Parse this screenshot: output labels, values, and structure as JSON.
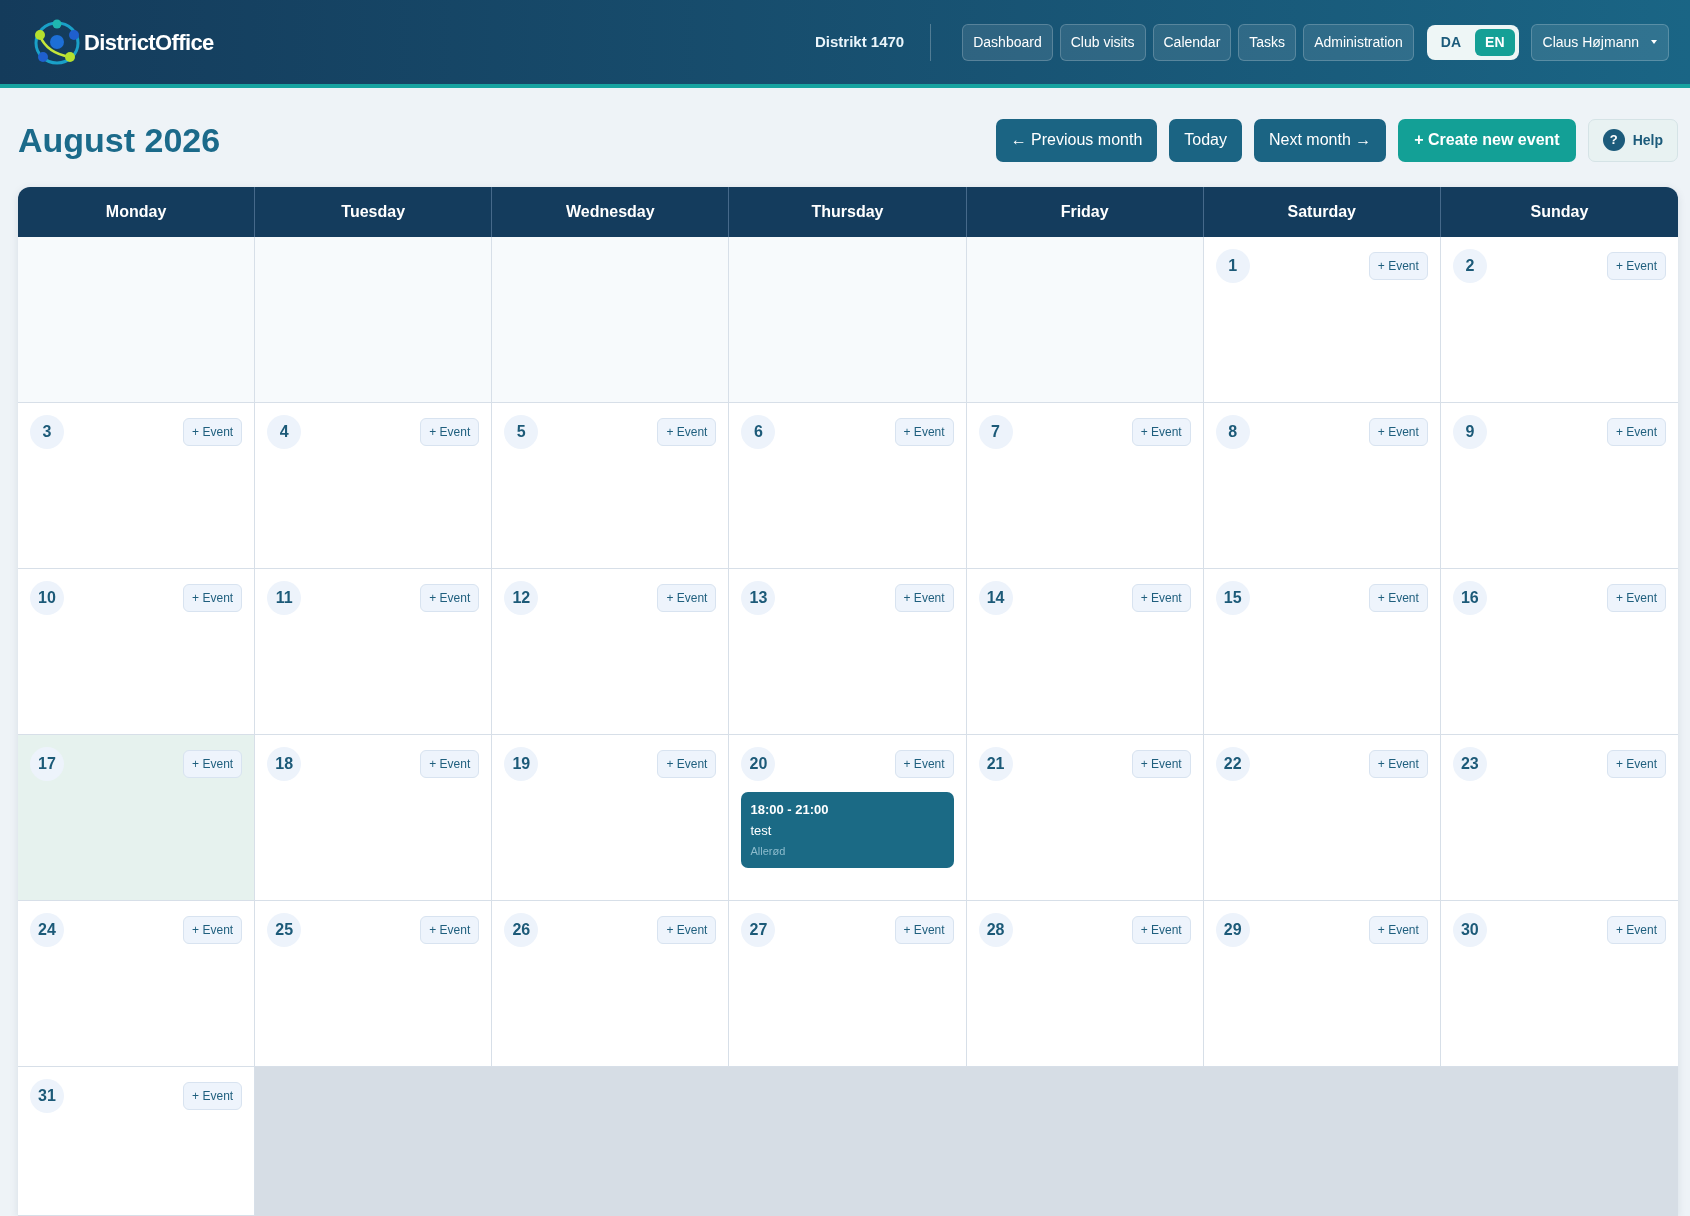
{
  "header": {
    "logo_text": "DistrictOffice",
    "district": "Distrikt 1470",
    "nav": [
      "Dashboard",
      "Club visits",
      "Calendar",
      "Tasks",
      "Administration"
    ],
    "languages": [
      {
        "label": "DA",
        "selected": false
      },
      {
        "label": "EN",
        "selected": true
      }
    ],
    "user": "Claus Højmann"
  },
  "toolbar": {
    "title": "August 2026",
    "buttons": [
      {
        "kind": "nav",
        "label": "← Previous month"
      },
      {
        "kind": "nav",
        "label": "Today"
      },
      {
        "kind": "nav",
        "label": "Next month →"
      },
      {
        "kind": "primary",
        "label": "+ Create new event"
      },
      {
        "kind": "help",
        "icon": "?",
        "label": "Help"
      }
    ]
  },
  "calendar": {
    "weekdays": [
      "Monday",
      "Tuesday",
      "Wednesday",
      "Thursday",
      "Friday",
      "Saturday",
      "Sunday"
    ],
    "weeks": [
      [
        {
          "kind": "lead"
        },
        {
          "kind": "lead"
        },
        {
          "kind": "lead"
        },
        {
          "kind": "lead"
        },
        {
          "kind": "lead"
        },
        {
          "kind": "day",
          "day": "1",
          "add": "+ Event",
          "today": false
        },
        {
          "kind": "day",
          "day": "2",
          "add": "+ Event",
          "today": false
        }
      ],
      [
        {
          "kind": "day",
          "day": "3",
          "add": "+ Event",
          "today": false
        },
        {
          "kind": "day",
          "day": "4",
          "add": "+ Event",
          "today": false
        },
        {
          "kind": "day",
          "day": "5",
          "add": "+ Event",
          "today": false
        },
        {
          "kind": "day",
          "day": "6",
          "add": "+ Event",
          "today": false
        },
        {
          "kind": "day",
          "day": "7",
          "add": "+ Event",
          "today": false
        },
        {
          "kind": "day",
          "day": "8",
          "add": "+ Event",
          "today": false
        },
        {
          "kind": "day",
          "day": "9",
          "add": "+ Event",
          "today": false
        }
      ],
      [
        {
          "kind": "day",
          "day": "10",
          "add": "+ Event",
          "today": false
        },
        {
          "kind": "day",
          "day": "11",
          "add": "+ Event",
          "today": false
        },
        {
          "kind": "day",
          "day": "12",
          "add": "+ Event",
          "today": false
        },
        {
          "kind": "day",
          "day": "13",
          "add": "+ Event",
          "today": false
        },
        {
          "kind": "day",
          "day": "14",
          "add": "+ Event",
          "today": false
        },
        {
          "kind": "day",
          "day": "15",
          "add": "+ Event",
          "today": false
        },
        {
          "kind": "day",
          "day": "16",
          "add": "+ Event",
          "today": false
        }
      ],
      [
        {
          "kind": "day",
          "day": "17",
          "add": "+ Event",
          "today": true
        },
        {
          "kind": "day",
          "day": "18",
          "add": "+ Event",
          "today": false
        },
        {
          "kind": "day",
          "day": "19",
          "add": "+ Event",
          "today": false
        },
        {
          "kind": "day",
          "day": "20",
          "add": "+ Event",
          "today": false,
          "events": [
            {
              "time": "18:00 - 21:00",
              "title": "test",
              "location": "Allerød"
            }
          ]
        },
        {
          "kind": "day",
          "day": "21",
          "add": "+ Event",
          "today": false
        },
        {
          "kind": "day",
          "day": "22",
          "add": "+ Event",
          "today": false
        },
        {
          "kind": "day",
          "day": "23",
          "add": "+ Event",
          "today": false
        }
      ],
      [
        {
          "kind": "day",
          "day": "24",
          "add": "+ Event",
          "today": false
        },
        {
          "kind": "day",
          "day": "25",
          "add": "+ Event",
          "today": false
        },
        {
          "kind": "day",
          "day": "26",
          "add": "+ Event",
          "today": false
        },
        {
          "kind": "day",
          "day": "27",
          "add": "+ Event",
          "today": false
        },
        {
          "kind": "day",
          "day": "28",
          "add": "+ Event",
          "today": false
        },
        {
          "kind": "day",
          "day": "29",
          "add": "+ Event",
          "today": false
        },
        {
          "kind": "day",
          "day": "30",
          "add": "+ Event",
          "today": false
        }
      ],
      [
        {
          "kind": "day",
          "day": "31",
          "add": "+ Event",
          "today": false
        },
        {
          "kind": "trail"
        },
        {
          "kind": "trail"
        },
        {
          "kind": "trail"
        },
        {
          "kind": "trail"
        },
        {
          "kind": "trail"
        },
        {
          "kind": "trail"
        }
      ]
    ]
  }
}
